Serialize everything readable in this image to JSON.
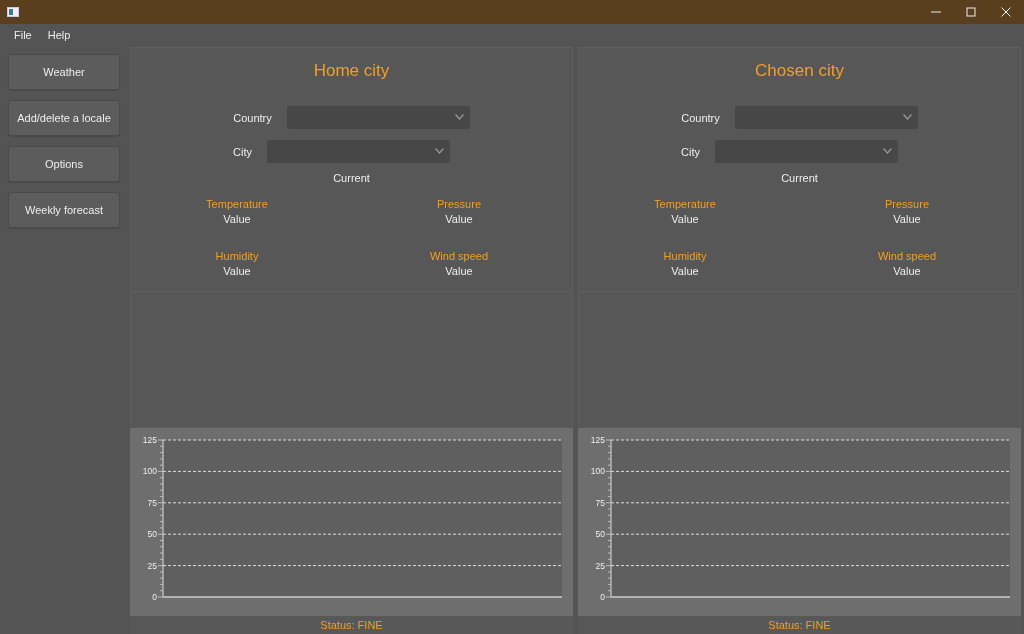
{
  "menu": [
    "File",
    "Help"
  ],
  "sidebar": {
    "buttons": [
      "Weather",
      "Add/delete a locale",
      "Options",
      "Weekly forecast"
    ]
  },
  "panels": [
    {
      "title": "Home city",
      "fields": [
        {
          "label": "Country"
        },
        {
          "label": "City"
        }
      ],
      "section_label": "Current",
      "metrics": [
        {
          "label": "Temperature",
          "value": "Value"
        },
        {
          "label": "Pressure",
          "value": "Value"
        },
        {
          "label": "Humidity",
          "value": "Value"
        },
        {
          "label": "Wind speed",
          "value": "Value"
        }
      ],
      "chart": {
        "y_axis_labels": [
          "125",
          "100",
          "75",
          "50",
          "25",
          "0"
        ]
      },
      "status": "Status: FINE"
    },
    {
      "title": "Chosen city",
      "fields": [
        {
          "label": "Country"
        },
        {
          "label": "City"
        }
      ],
      "section_label": "Current",
      "metrics": [
        {
          "label": "Temperature",
          "value": "Value"
        },
        {
          "label": "Pressure",
          "value": "Value"
        },
        {
          "label": "Humidity",
          "value": "Value"
        },
        {
          "label": "Wind speed",
          "value": "Value"
        }
      ],
      "chart": {
        "y_axis_labels": [
          "125",
          "100",
          "75",
          "50",
          "25",
          "0"
        ]
      },
      "status": "Status: FINE"
    }
  ]
}
